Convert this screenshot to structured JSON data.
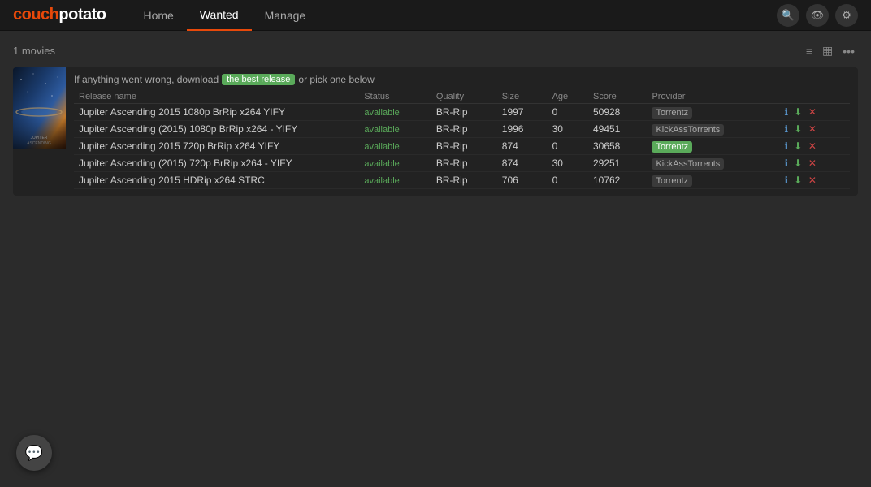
{
  "header": {
    "logo": "couchpotato",
    "nav": [
      {
        "label": "Home",
        "active": false
      },
      {
        "label": "Wanted",
        "active": true
      },
      {
        "label": "Manage",
        "active": false
      }
    ],
    "icons": [
      {
        "name": "search-icon",
        "symbol": "🔍"
      },
      {
        "name": "eye-icon",
        "symbol": "👁"
      },
      {
        "name": "gear-icon",
        "symbol": "⚙"
      }
    ]
  },
  "content": {
    "movies_count_label": "1 movies",
    "notice_prefix": "If anything went wrong, download",
    "best_release_badge": "the best release",
    "notice_suffix": "or pick one below",
    "columns": [
      "Release name",
      "Status",
      "Quality",
      "Size",
      "Age",
      "Score",
      "Provider"
    ],
    "releases": [
      {
        "name": "Jupiter Ascending 2015 1080p BrRip x264 YIFY",
        "status": "available",
        "quality": "BR-Rip",
        "size": "1997",
        "age": "0",
        "score": "50928",
        "provider": "Torrentz",
        "highlight": false
      },
      {
        "name": "Jupiter Ascending (2015) 1080p BrRip x264 - YIFY",
        "status": "available",
        "quality": "BR-Rip",
        "size": "1996",
        "age": "30",
        "score": "49451",
        "provider": "KickAssTorrents",
        "highlight": false
      },
      {
        "name": "Jupiter Ascending 2015 720p BrRip x264 YIFY",
        "status": "available",
        "quality": "BR-Rip",
        "size": "874",
        "age": "0",
        "score": "30658",
        "provider": "Torrentz",
        "highlight": true
      },
      {
        "name": "Jupiter Ascending (2015) 720p BrRip x264 - YIFY",
        "status": "available",
        "quality": "BR-Rip",
        "size": "874",
        "age": "30",
        "score": "29251",
        "provider": "KickAssTorrents",
        "highlight": false
      },
      {
        "name": "Jupiter Ascending 2015 HDRip x264 STRC",
        "status": "available",
        "quality": "BR-Rip",
        "size": "706",
        "age": "0",
        "score": "10762",
        "provider": "Torrentz",
        "highlight": false
      }
    ],
    "movie": {
      "poster_title": "JUPITER ASCENDING"
    }
  },
  "feedback": {
    "button_symbol": "💬"
  }
}
